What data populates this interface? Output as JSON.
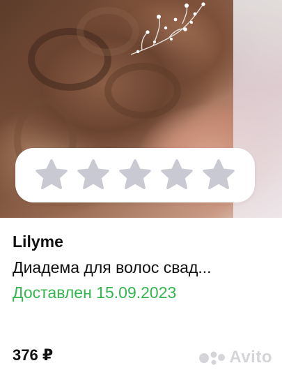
{
  "product_card": {
    "seller": "Lilyme",
    "title": "Диадема для волос свад...",
    "status": "Доставлен 15.09.2023",
    "price": "376 ₽",
    "rating": {
      "value": 0,
      "max": 5
    },
    "photo_alt": "hairpin-in-hair-photo"
  },
  "watermark": {
    "text": "Avito"
  },
  "colors": {
    "status_green": "#33b64e",
    "star_empty": "#c9c9d3",
    "text_primary": "#111111"
  }
}
